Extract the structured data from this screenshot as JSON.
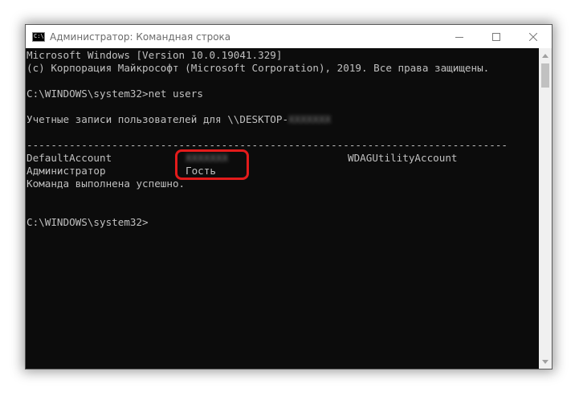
{
  "window": {
    "title": "Администратор: Командная строка",
    "icon": "cmd-icon",
    "icon_label": "C:\\"
  },
  "controls": {
    "minimize": "minimize-icon",
    "maximize": "maximize-icon",
    "close": "close-icon"
  },
  "console": {
    "line1": "Microsoft Windows [Version 10.0.19041.329]",
    "line2": "(c) Корпорация Майкрософт (Microsoft Corporation), 2019. Все права защищены.",
    "prompt1": "C:\\WINDOWS\\system32>",
    "command": "net users",
    "accounts_header": "Учетные записи пользователей для \\\\DESKTOP-",
    "hostname_redacted": "XXXXXXX",
    "separator": "-------------------------------------------------------------------------------",
    "accounts": [
      "DefaultAccount",
      "Администратор",
      "XXXXXXX",
      "Гость",
      "WDAGUtilityAccount"
    ],
    "completion": "Команда выполнена успешно.",
    "prompt2": "C:\\WINDOWS\\system32>"
  },
  "colors": {
    "console_bg": "#0c0c0c",
    "console_text": "#c0c0c0",
    "highlight": "#e31b1b"
  }
}
